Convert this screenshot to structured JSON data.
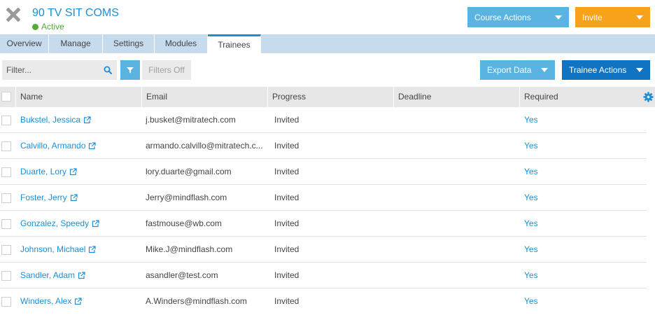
{
  "header": {
    "course_title": "90 TV SIT COMS",
    "status": "Active",
    "course_actions_label": "Course Actions",
    "invite_label": "Invite"
  },
  "tabs": [
    {
      "label": "Overview",
      "active": false
    },
    {
      "label": "Manage",
      "active": false
    },
    {
      "label": "Settings",
      "active": false
    },
    {
      "label": "Modules",
      "active": false
    },
    {
      "label": "Trainees",
      "active": true
    }
  ],
  "toolbar": {
    "filter_placeholder": "Filter...",
    "filters_state": "Filters Off",
    "export_label": "Export Data",
    "trainee_actions_label": "Trainee Actions"
  },
  "table": {
    "columns": [
      "Name",
      "Email",
      "Progress",
      "Deadline",
      "Required"
    ],
    "rows": [
      {
        "name": "Bukstel, Jessica",
        "email": "j.busket@mitratech.com",
        "progress": "Invited",
        "deadline": "",
        "required": "Yes"
      },
      {
        "name": "Calvillo, Armando",
        "email": "armando.calvillo@mitratech.c...",
        "progress": "Invited",
        "deadline": "",
        "required": "Yes"
      },
      {
        "name": "Duarte, Lory",
        "email": "lory.duarte@gmail.com",
        "progress": "Invited",
        "deadline": "",
        "required": "Yes"
      },
      {
        "name": "Foster, Jerry",
        "email": "Jerry@mindflash.com",
        "progress": "Invited",
        "deadline": "",
        "required": "Yes"
      },
      {
        "name": "Gonzalez, Speedy",
        "email": "fastmouse@wb.com",
        "progress": "Invited",
        "deadline": "",
        "required": "Yes"
      },
      {
        "name": "Johnson, Michael",
        "email": "Mike.J@mindflash.com",
        "progress": "Invited",
        "deadline": "",
        "required": "Yes"
      },
      {
        "name": "Sandler, Adam",
        "email": "asandler@test.com",
        "progress": "Invited",
        "deadline": "",
        "required": "Yes"
      },
      {
        "name": "Winders, Alex",
        "email": "A.Winders@mindflash.com",
        "progress": "Invited",
        "deadline": "",
        "required": "Yes"
      }
    ]
  },
  "colors": {
    "accent": "#1a8fd6",
    "button_light_blue": "#5ab3e1",
    "button_dark_blue": "#1174c2",
    "invite_orange": "#f7a21b",
    "active_green": "#56a83a",
    "tab_bar": "#c7dbee"
  },
  "icons": {
    "close": "close-icon",
    "search": "search-icon",
    "filter": "funnel-icon",
    "settings": "gear-icon",
    "external_link": "external-link-icon"
  }
}
